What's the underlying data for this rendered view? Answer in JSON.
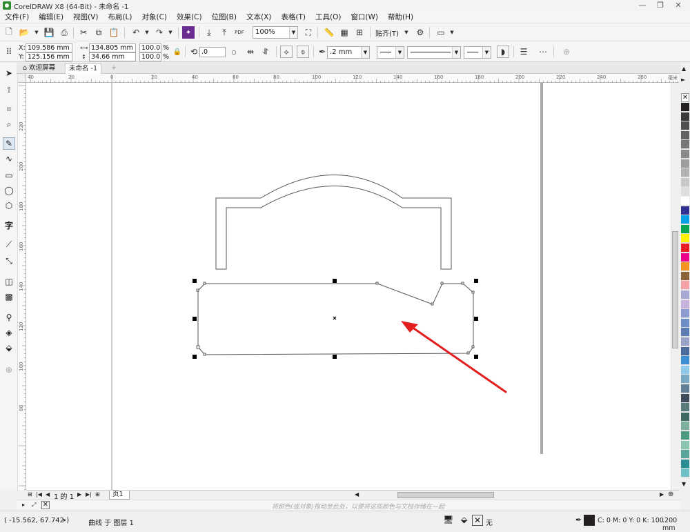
{
  "window": {
    "title": "CorelDRAW X8 (64-Bit) - 未命名 -1",
    "controls": [
      "minimize",
      "restore",
      "close"
    ]
  },
  "menu": [
    "文件(F)",
    "编辑(E)",
    "视图(V)",
    "布局(L)",
    "对象(C)",
    "效果(C)",
    "位图(B)",
    "文本(X)",
    "表格(T)",
    "工具(O)",
    "窗口(W)",
    "帮助(H)"
  ],
  "toolbar": {
    "zoom": "100%",
    "snap_label": "贴齐(T)",
    "pdf_label": "PDF"
  },
  "property_bar": {
    "x_label": "X:",
    "x_value": "109.586 mm",
    "y_label": "Y:",
    "y_value": "125.156 mm",
    "width_value": "134.805 mm",
    "height_value": "34.66 mm",
    "scale_x": "100.0",
    "scale_y": "100.0",
    "percent": "%",
    "rotation": ".0",
    "outline_width": ".2 mm"
  },
  "doc_tabs": {
    "welcome": "欢迎屏幕",
    "document": "未命名 -1",
    "add": "+"
  },
  "ruler": {
    "h_labels": [
      "40",
      "20",
      "0",
      "20",
      "40",
      "60",
      "80",
      "100",
      "120",
      "140",
      "160",
      "180",
      "200",
      "220",
      "240",
      "260"
    ],
    "h_unit": "毫米",
    "v_labels": [
      "220",
      "200",
      "180",
      "160",
      "140",
      "120",
      "100",
      "80"
    ]
  },
  "page_nav": {
    "page_count": "1 的 1",
    "page_tab": "页1"
  },
  "hint": "将颜色(或对象)拖动至此处，以便将这些颜色与文档存储在一起",
  "status": {
    "coords": "( -15.562, 67.742 )",
    "object_info": "曲线 于 图层 1",
    "fill_none": "无",
    "color_info": "C: 0 M: 0 Y: 0 K: 100",
    "outline_info": ".200 mm"
  },
  "palette": [
    "#231f20",
    "#3a3a3a",
    "#505050",
    "#636363",
    "#777777",
    "#8a8a8a",
    "#9e9e9e",
    "#b3b3b3",
    "#c8c8c8",
    "#dedede",
    "#ffffff",
    "#2e3192",
    "#00a0e3",
    "#00a650",
    "#fff200",
    "#ed1c24",
    "#ec008c",
    "#f7941d",
    "#8c6239",
    "#f5a3a8",
    "#a9a9d6",
    "#c7b2de",
    "#8e9bd1",
    "#6d8fc7",
    "#5b7db1",
    "#9aa3c9",
    "#4b6a9c",
    "#3b8fd2",
    "#8ec8eb",
    "#7aa9c6",
    "#5e7f96",
    "#3e4d5c",
    "#587a7a",
    "#3d6b63",
    "#7fb09d",
    "#4d9a80",
    "#8cc5b0",
    "#5aa69c",
    "#2a8c95",
    "#6ec1c8"
  ],
  "colors": {
    "arrow": "#e21e1e",
    "outline": "#555555"
  }
}
